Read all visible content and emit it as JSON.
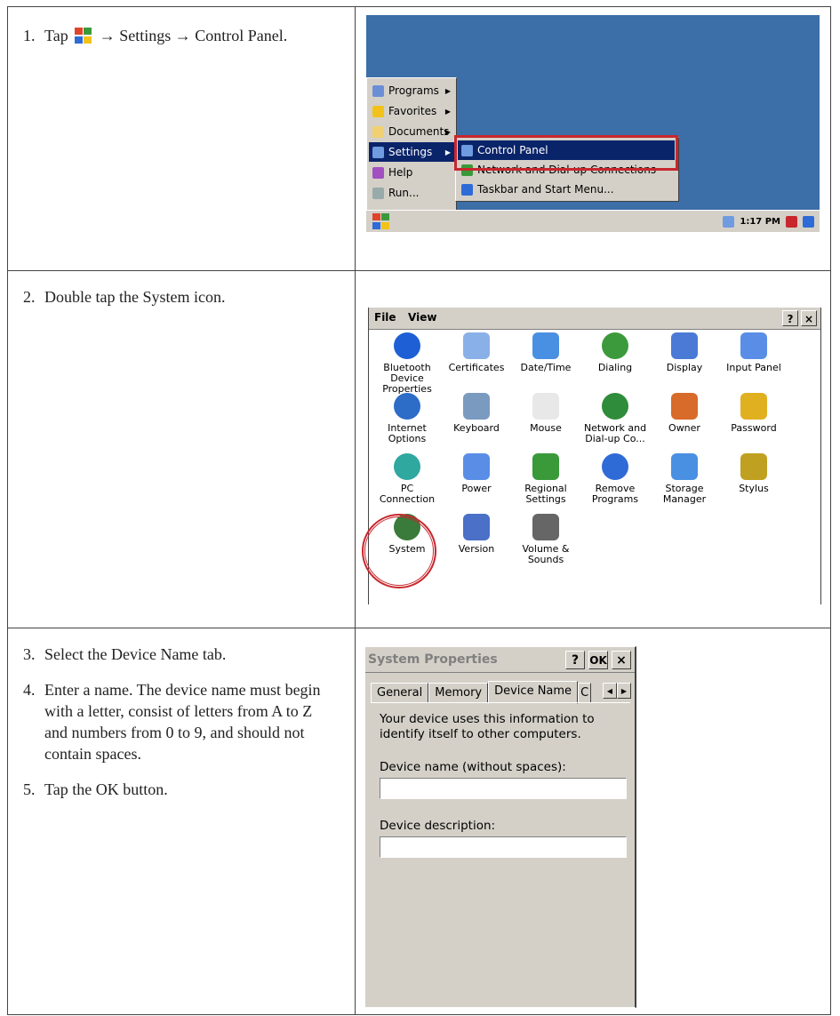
{
  "steps": [
    {
      "n": "1.",
      "pre": "Tap",
      "text": "→ Settings → Control Panel."
    },
    {
      "n": "2.",
      "text": "Double tap the System icon."
    },
    {
      "n": "3.",
      "text": "Select the Device Name tab."
    },
    {
      "n": "4.",
      "text": "Enter a name. The device name must begin with a letter, consist of letters from A to Z and numbers from 0 to 9, and should not contain spaces."
    },
    {
      "n": "5.",
      "text": "Tap the OK button."
    }
  ],
  "start_menu": {
    "items": [
      "Programs",
      "Favorites",
      "Documents",
      "Settings",
      "Help",
      "Run..."
    ],
    "submenu": [
      "Control Panel",
      "Network and Dial-up Connections",
      "Taskbar and Start Menu..."
    ],
    "clock": "1:17 PM"
  },
  "control_panel": {
    "menu": {
      "file": "File",
      "view": "View"
    },
    "help_btn": "?",
    "close_btn": "×",
    "icons": [
      "Bluetooth Device Properties",
      "Certificates",
      "Date/Time",
      "Dialing",
      "Display",
      "Input Panel",
      "Internet Options",
      "Keyboard",
      "Mouse",
      "Network and Dial-up Co...",
      "Owner",
      "Password",
      "PC Connection",
      "Power",
      "Regional Settings",
      "Remove Programs",
      "Storage Manager",
      "Stylus",
      "System",
      "Version",
      "Volume & Sounds"
    ]
  },
  "system_properties": {
    "title": "System Properties",
    "help_btn": "?",
    "ok_btn": "OK",
    "close_btn": "×",
    "tabs": [
      "General",
      "Memory",
      "Device Name",
      "C"
    ],
    "info": "Your device uses this information to identify itself to other computers.",
    "name_label": "Device name (without spaces):",
    "name_value": "",
    "desc_label": "Device description:",
    "desc_value": ""
  }
}
